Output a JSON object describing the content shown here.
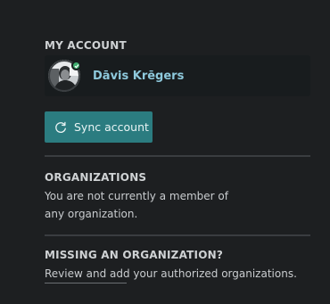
{
  "my_account": {
    "title": "MY ACCOUNT",
    "user_name": "Dāvis Krēgers",
    "status": "online",
    "status_color": "#3fae6f",
    "name_color": "#8ec9dc"
  },
  "sync": {
    "label": "Sync account",
    "icon": "sync-icon",
    "color": "#2b7c80"
  },
  "organizations": {
    "title": "ORGANIZATIONS",
    "line1": "You are not currently a member of",
    "line2": "any organization."
  },
  "missing": {
    "title": "MISSING AN ORGANIZATION?",
    "text": "Review and add your authorized organizations."
  }
}
